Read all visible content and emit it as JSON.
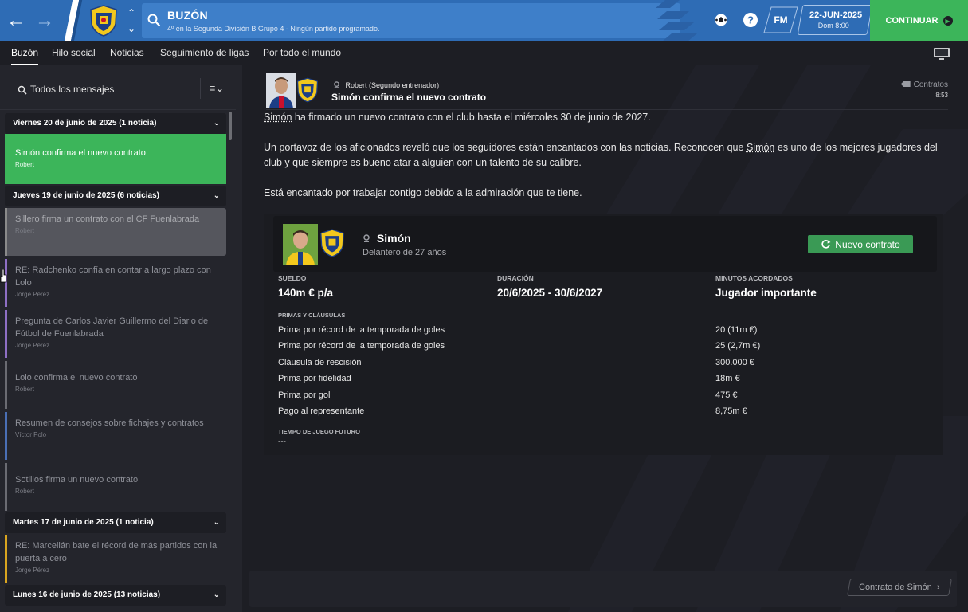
{
  "header": {
    "title": "BUZÓN",
    "subtitle": "4º en la Segunda División B Grupo 4 - Ningún partido programado.",
    "date": "22-JUN-2025",
    "date_sub": "Dom 8:00",
    "fm_label": "FM",
    "continue_label": "CONTINUAR",
    "help_label": "?"
  },
  "tabs": [
    {
      "label": "Buzón",
      "active": true
    },
    {
      "label": "Hilo social"
    },
    {
      "label": "Noticias"
    },
    {
      "label": "Seguimiento de ligas"
    },
    {
      "label": "Por todo el mundo"
    }
  ],
  "inbox": {
    "filter_label": "Todos los mensajes",
    "groups": [
      {
        "label": "Viernes 20 de junio de 2025 (1 noticia)"
      },
      {
        "label": "Jueves 19 de junio de 2025 (6 noticias)"
      },
      {
        "label": "Martes 17 de junio de 2025 (1 noticia)"
      },
      {
        "label": "Lunes 16 de junio de 2025 (13 noticias)"
      }
    ],
    "messages": [
      {
        "title": "Simón confirma el nuevo contrato",
        "from": "Robert",
        "color": "#3cb55a"
      },
      {
        "title": "Sillero firma un contrato con el CF Fuenlabrada",
        "from": "Robert",
        "color": "#8a8a8a"
      },
      {
        "title": "RE: Radchenko confía en contar a largo plazo con Lolo",
        "from": "Jorge Pérez",
        "color": "#8e6fc4"
      },
      {
        "title": "Pregunta de Carlos Javier Guillermo del Diario de Fútbol de Fuenlabrada",
        "from": "Jorge Pérez",
        "color": "#8e6fc4"
      },
      {
        "title": "Lolo confirma el nuevo contrato",
        "from": "Robert",
        "color": "#6a6b72"
      },
      {
        "title": "Resumen de consejos sobre fichajes y contratos",
        "from": "Víctor Polo",
        "color": "#4a6fb5"
      },
      {
        "title": "Sotillos firma un nuevo contrato",
        "from": "Robert",
        "color": "#6a6b72"
      },
      {
        "title": "RE: Marcellán bate el récord de más partidos con la puerta a cero",
        "from": "Jorge Pérez",
        "color": "#d9a520"
      }
    ]
  },
  "message": {
    "from": "Robert",
    "from_role": "(Segundo entrenador)",
    "title": "Simón confirma el nuevo contrato",
    "category": "Contratos",
    "time": "8:53",
    "p1_name": "Simón",
    "p1_rest": " ha firmado un nuevo contrato con el club hasta el miércoles 30 de junio de 2027.",
    "p2_a": "Un portavoz de los aficionados reveló que los seguidores están encantados con las noticias. Reconocen que ",
    "p2_name": "Simón",
    "p2_b": " es uno de los mejores jugadores del club y que siempre es bueno atar a alguien con un talento de su calibre.",
    "p3": "Está encantado por trabajar contigo debido a la admiración que te tiene."
  },
  "contract": {
    "player_name": "Simón",
    "player_role": "Delantero de 27 años",
    "badge": "Nuevo contrato",
    "salary_label": "SUELDO",
    "salary": "140m € p/a",
    "duration_label": "DURACIÓN",
    "duration": "20/6/2025 - 30/6/2027",
    "minutes_label": "MINUTOS ACORDADOS",
    "minutes": "Jugador importante",
    "bonuses_label": "PRIMAS Y CLÁUSULAS",
    "bonuses": [
      {
        "name": "Prima por récord de la temporada de goles",
        "value": "20 (11m €)"
      },
      {
        "name": "Prima por récord de la temporada de goles",
        "value": "25 (2,7m €)"
      },
      {
        "name": "Cláusula de rescisión",
        "value": "300.000 €"
      },
      {
        "name": "Prima por fidelidad",
        "value": "18m €"
      },
      {
        "name": "Prima por gol",
        "value": "475 €"
      },
      {
        "name": "Pago al representante",
        "value": "8,75m €"
      }
    ],
    "future_label": "TIEMPO DE JUEGO FUTURO",
    "future_value": "---"
  },
  "footer": {
    "button_label": "Contrato de Simón"
  },
  "colors": {
    "accent_blue": "#2e6cb5",
    "accent_green": "#3cb55a",
    "background": "#1d1e24"
  }
}
